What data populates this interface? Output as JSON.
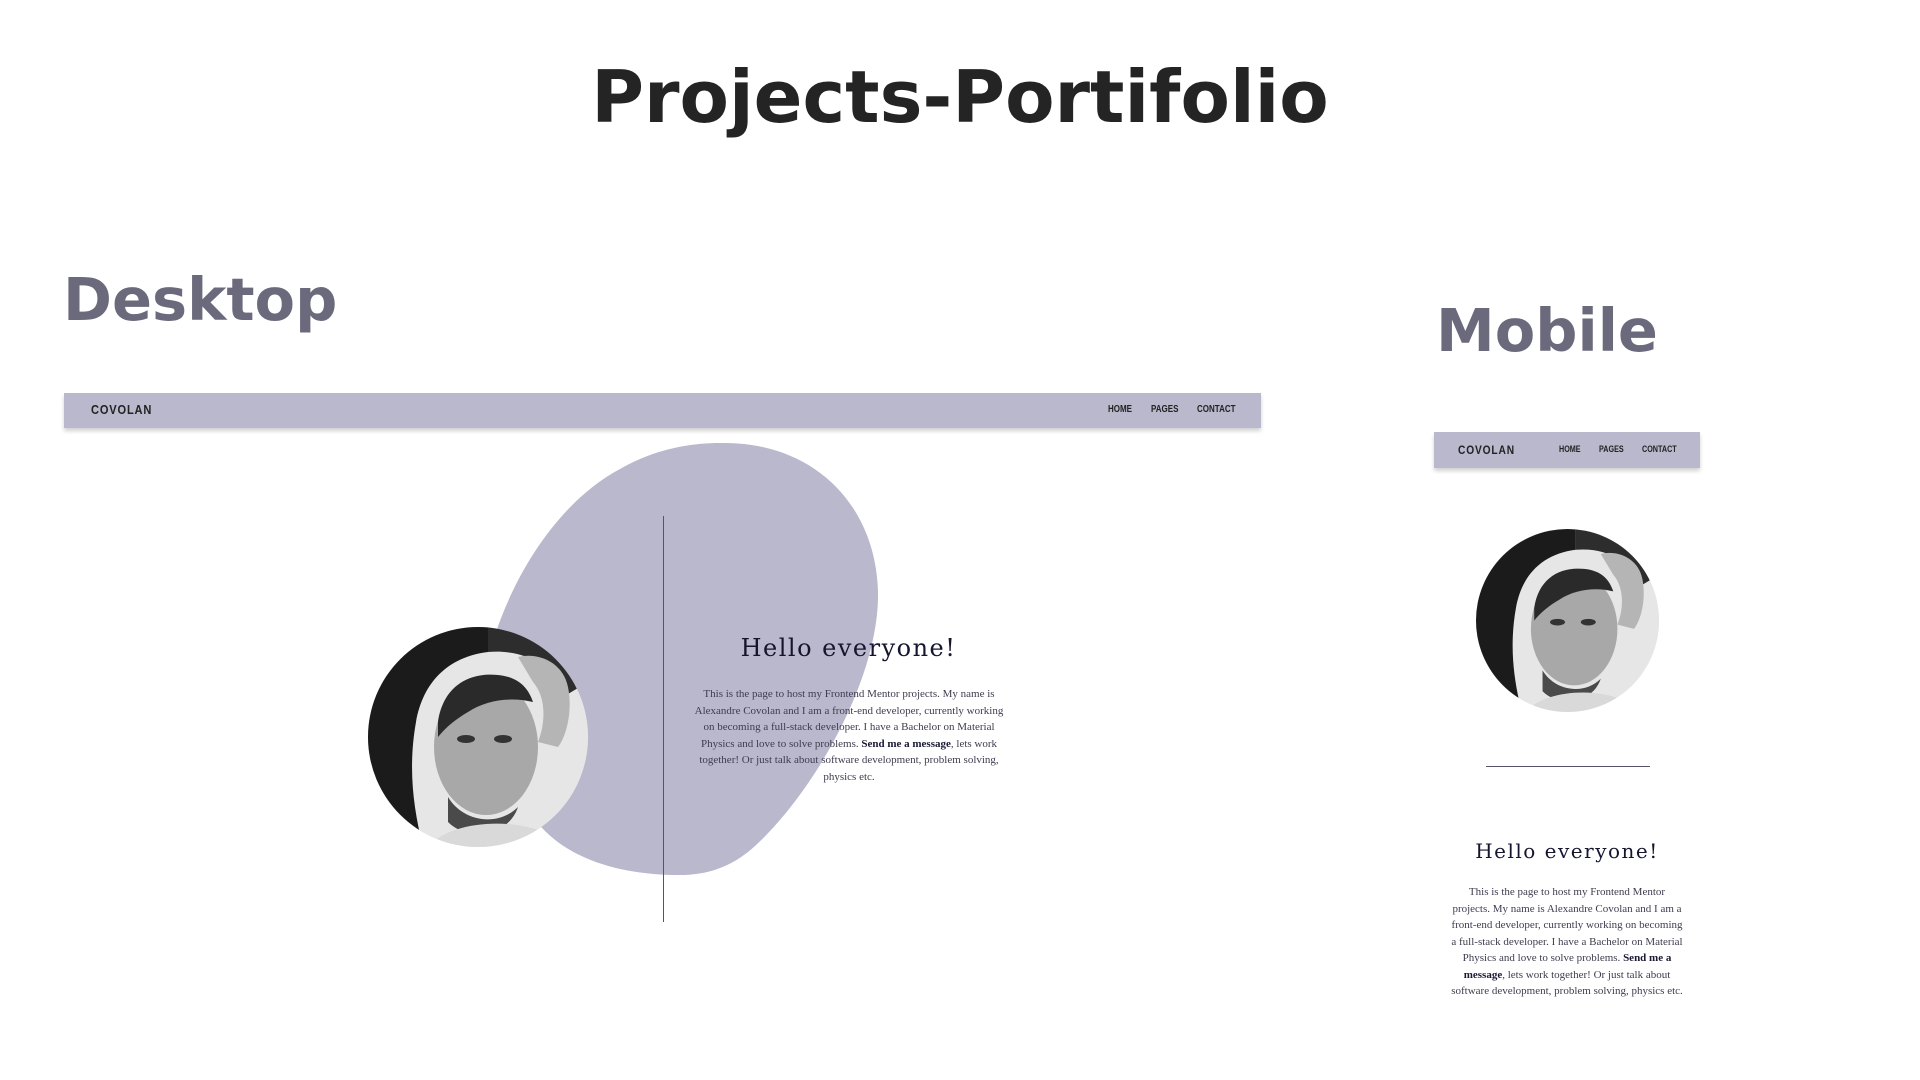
{
  "page": {
    "title": "Projects-Portifolio"
  },
  "sections": {
    "desktop_label": "Desktop",
    "mobile_label": "Mobile"
  },
  "colors": {
    "nav_bg": "#b9b8cc",
    "blob": "#b9b8cc",
    "label": "#6b6a7c",
    "heading": "#16152f"
  },
  "desktop": {
    "nav": {
      "logo": "COVOLAN",
      "links": [
        "HOME",
        "PAGES",
        "CONTACT"
      ]
    },
    "hero": {
      "heading": "Hello everyone!",
      "body_before": "This is the page to host my Frontend Mentor projects. My name is Alexandre Covolan and I am a front-end developer, currently working on becoming a full-stack developer. I have a Bachelor on Material Physics and love to solve problems. ",
      "link_text": "Send me a message",
      "body_after": ", lets work together! Or just talk about software development, problem solving, physics etc."
    }
  },
  "mobile": {
    "nav": {
      "logo": "COVOLAN",
      "links": [
        "HOME",
        "PAGES",
        "CONTACT"
      ]
    },
    "hero": {
      "heading": "Hello everyone!",
      "body_before": "This is the page to host my Frontend Mentor projects. My name is Alexandre Covolan and I am a front-end developer, currently working on becoming a full-stack developer. I have a Bachelor on Material Physics and love to solve problems. ",
      "link_text": "Send me a message",
      "body_after": ", lets work together! Or just talk about software development, problem solving, physics etc."
    }
  }
}
